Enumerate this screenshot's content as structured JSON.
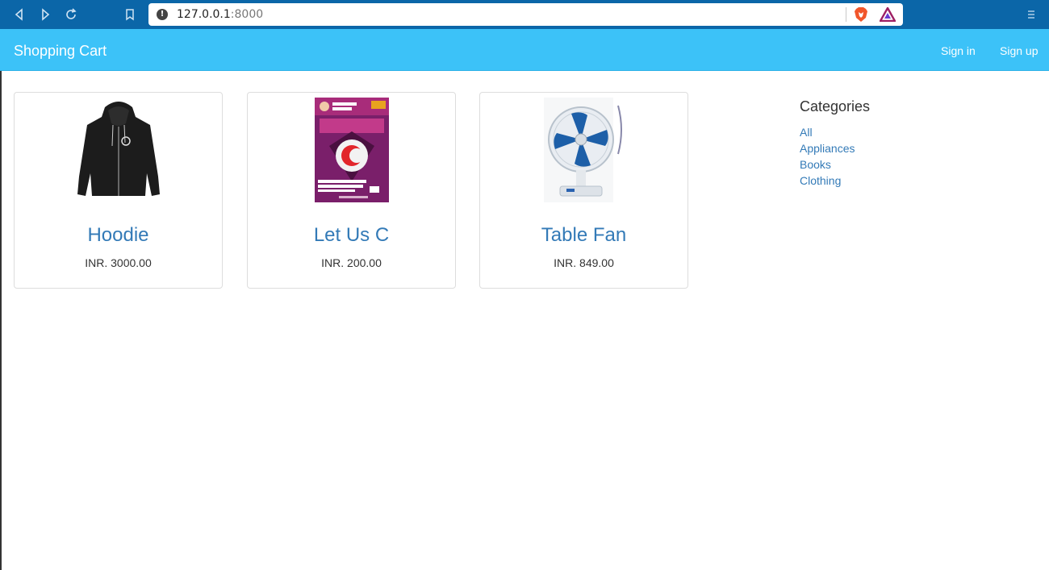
{
  "browser": {
    "url_host": "127.0.0.1",
    "url_port": ":8000",
    "icons": [
      "back-icon",
      "forward-icon",
      "reload-icon",
      "bookmark-icon",
      "site-info-icon",
      "brave-shield-icon",
      "brave-rewards-icon",
      "menu-icon"
    ]
  },
  "navbar": {
    "brand": "Shopping Cart",
    "sign_in": "Sign in",
    "sign_up": "Sign up",
    "background": "#3cc2f8"
  },
  "products": [
    {
      "name": "Hoodie",
      "price": "INR. 3000.00",
      "image": "hoodie-image"
    },
    {
      "name": "Let Us C",
      "price": "INR. 200.00",
      "image": "book-cover-image"
    },
    {
      "name": "Table Fan",
      "price": "INR. 849.00",
      "image": "table-fan-image"
    }
  ],
  "sidebar": {
    "title": "Categories",
    "links": [
      "All",
      "Appliances",
      "Books",
      "Clothing"
    ]
  },
  "colors": {
    "link": "#337ab7",
    "chrome": "#0b66a8"
  }
}
